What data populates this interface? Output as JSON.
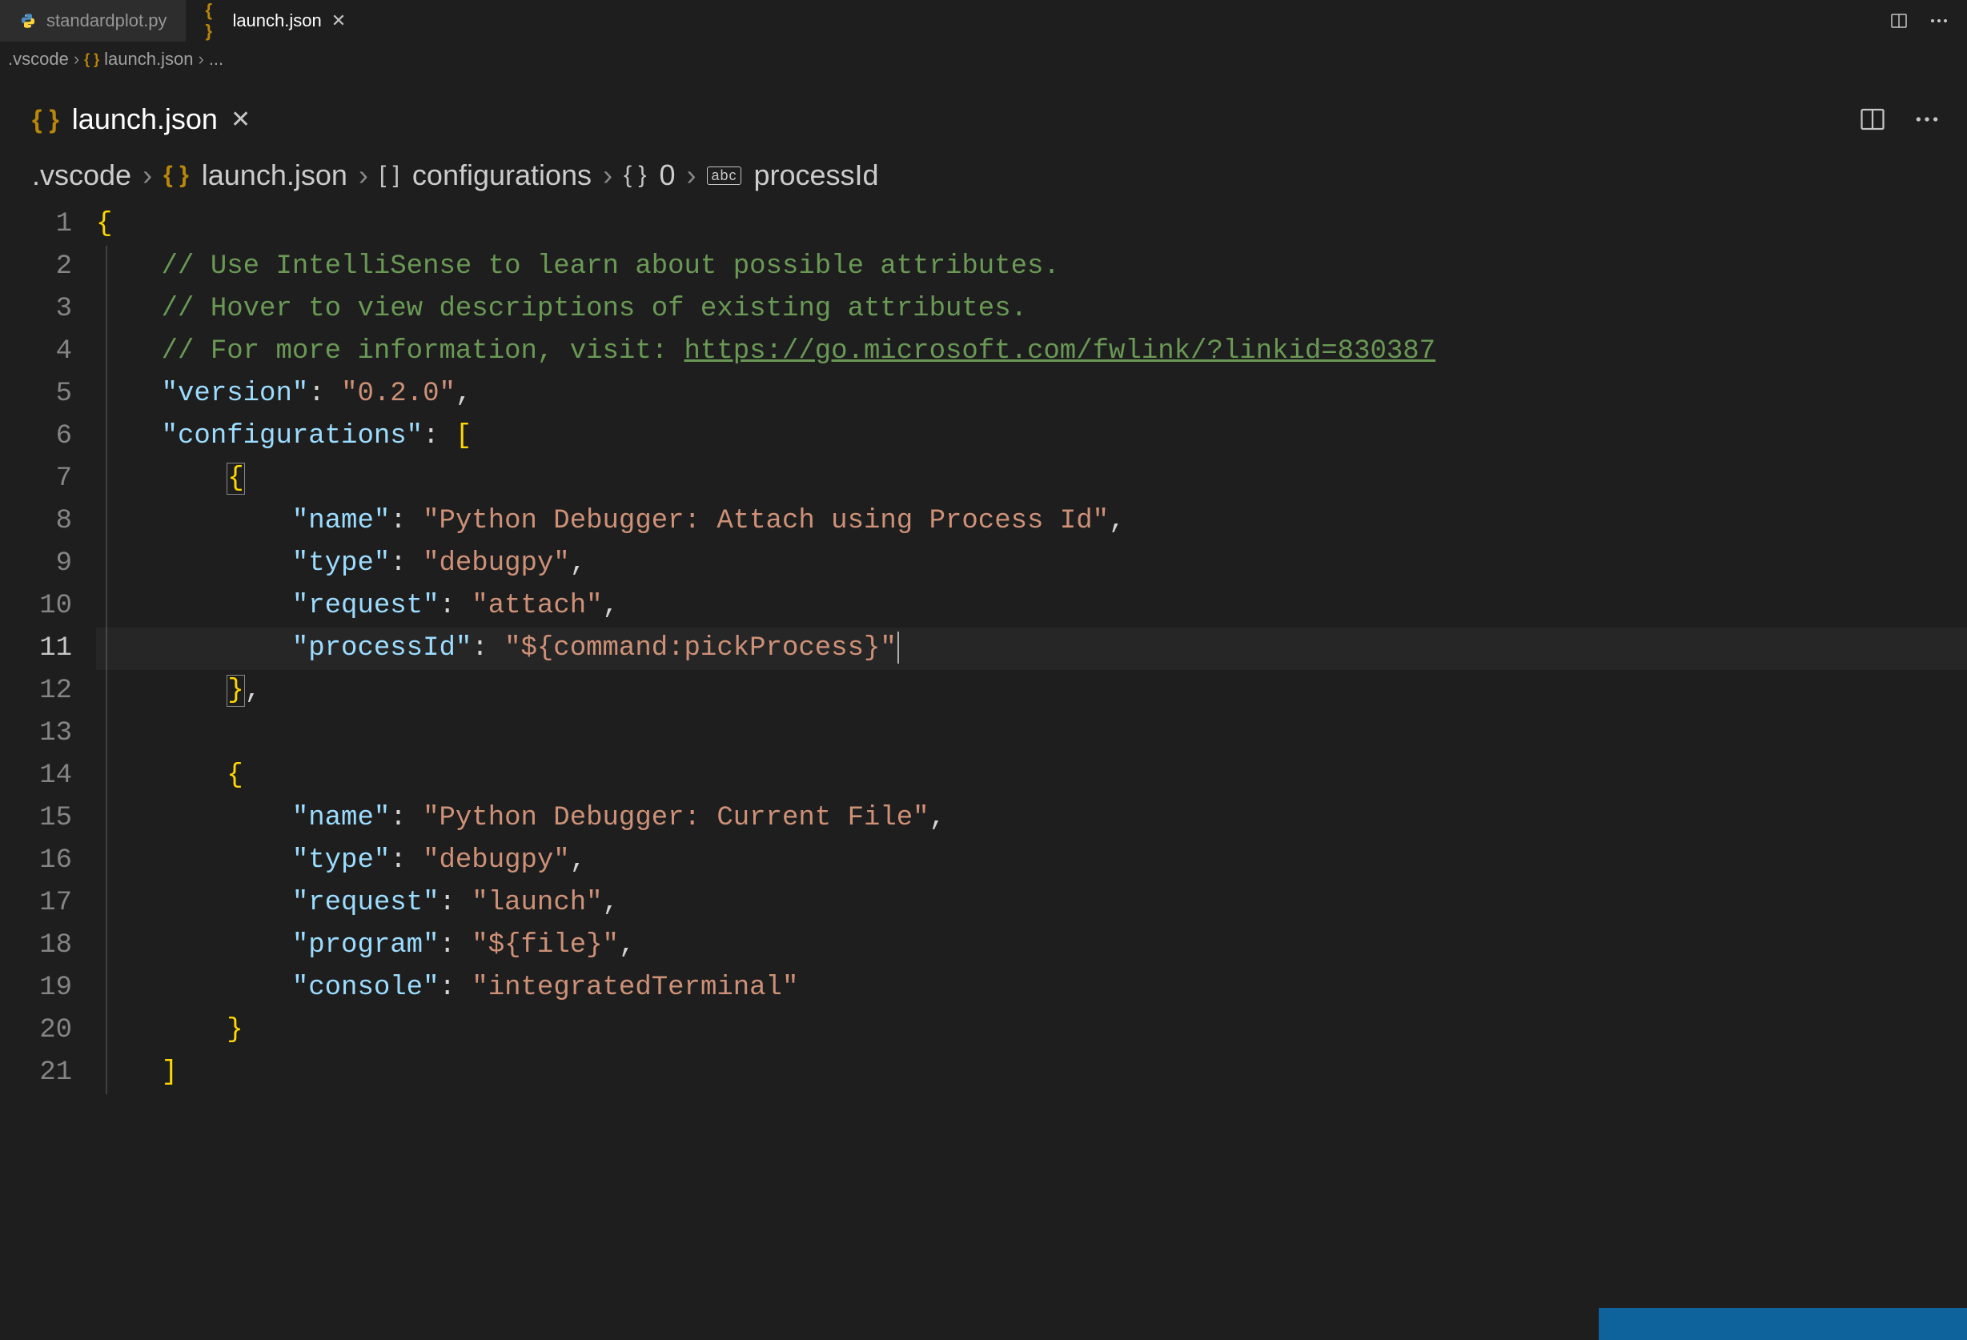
{
  "topTabs": {
    "inactive": {
      "label": "standardplot.py"
    },
    "active": {
      "label": "launch.json"
    }
  },
  "miniBreadcrumb": {
    "seg0": ".vscode",
    "seg1": "launch.json",
    "seg2": "..."
  },
  "editorTab": {
    "label": "launch.json"
  },
  "mainBreadcrumb": {
    "seg0": ".vscode",
    "seg1": "launch.json",
    "seg2": "configurations",
    "seg3": "0",
    "seg4": "processId"
  },
  "code": {
    "comment1": "// Use IntelliSense to learn about possible attributes.",
    "comment2": "// Hover to view descriptions of existing attributes.",
    "comment3a": "// For more information, visit: ",
    "comment3link": "https://go.microsoft.com/fwlink/?linkid=830387",
    "versionKey": "\"version\"",
    "versionVal": "\"0.2.0\"",
    "configsKey": "\"configurations\"",
    "cfg0_nameKey": "\"name\"",
    "cfg0_nameVal": "\"Python Debugger: Attach using Process Id\"",
    "cfg0_typeKey": "\"type\"",
    "cfg0_typeVal": "\"debugpy\"",
    "cfg0_reqKey": "\"request\"",
    "cfg0_reqVal": "\"attach\"",
    "cfg0_pidKey": "\"processId\"",
    "cfg0_pidVal": "\"${command:pickProcess}\"",
    "cfg1_nameKey": "\"name\"",
    "cfg1_nameVal": "\"Python Debugger: Current File\"",
    "cfg1_typeKey": "\"type\"",
    "cfg1_typeVal": "\"debugpy\"",
    "cfg1_reqKey": "\"request\"",
    "cfg1_reqVal": "\"launch\"",
    "cfg1_progKey": "\"program\"",
    "cfg1_progVal": "\"${file}\"",
    "cfg1_consKey": "\"console\"",
    "cfg1_consVal": "\"integratedTerminal\""
  },
  "lineNumbers": [
    "1",
    "2",
    "3",
    "4",
    "5",
    "6",
    "7",
    "8",
    "9",
    "10",
    "11",
    "12",
    "13",
    "14",
    "15",
    "16",
    "17",
    "18",
    "19",
    "20",
    "21"
  ],
  "activeLine": "11",
  "icons": {
    "abc": "abc"
  }
}
